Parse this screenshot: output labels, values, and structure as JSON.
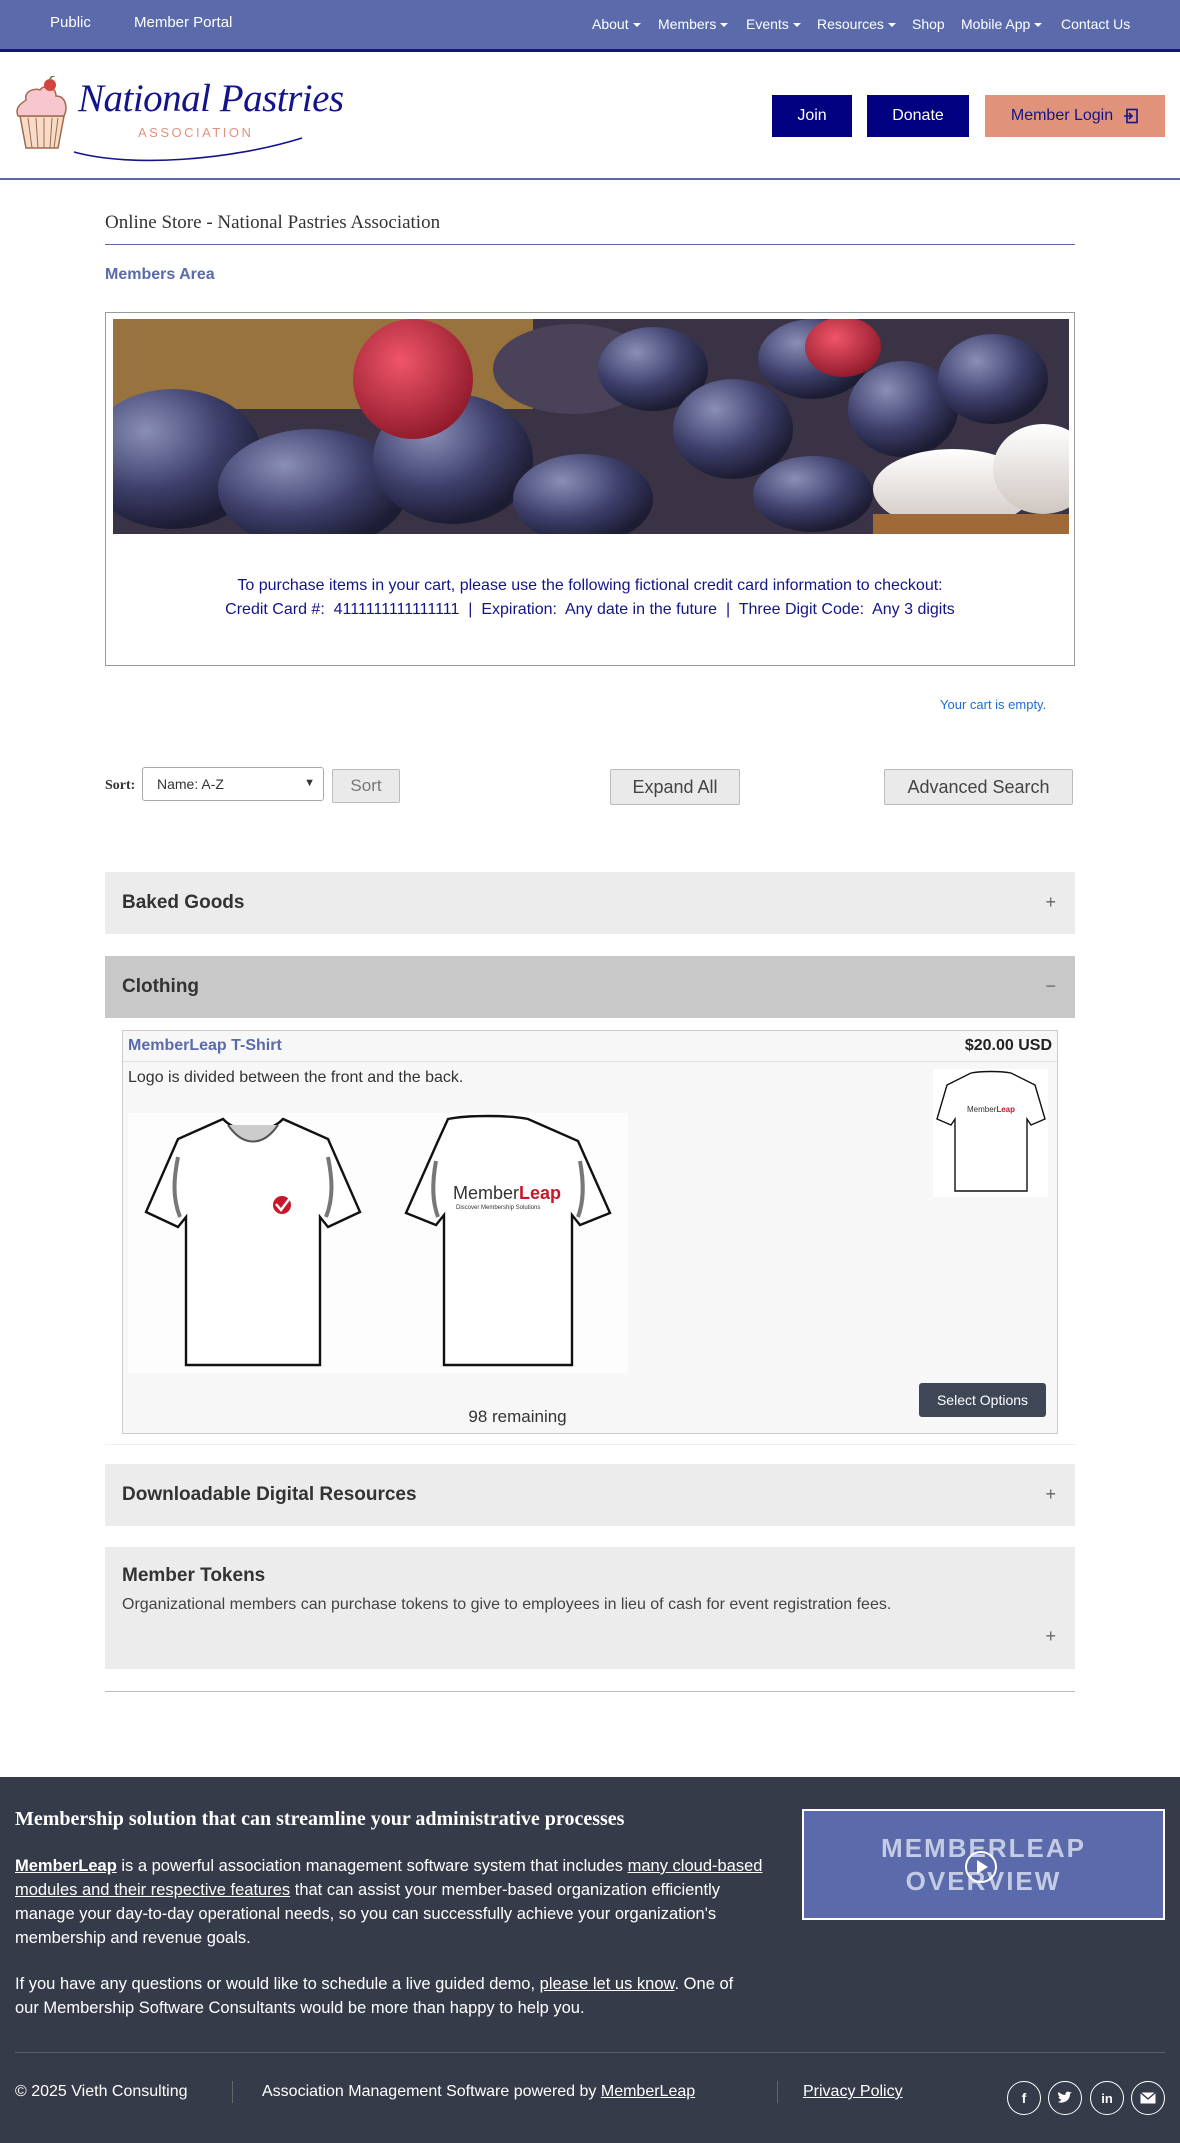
{
  "topbar": {
    "public": "Public",
    "member_portal": "Member Portal",
    "nav": [
      "About",
      "Members",
      "Events",
      "Resources",
      "Shop",
      "Mobile App",
      "Contact Us"
    ]
  },
  "logo": {
    "line1": "National Pastries",
    "line2": "ASSOCIATION"
  },
  "header_buttons": {
    "join": "Join",
    "donate": "Donate",
    "login": "Member Login"
  },
  "page": {
    "title": "Online Store - National Pastries Association",
    "members_area": "Members Area",
    "checkout_line1": "To purchase items in your cart, please use the following fictional credit card information to checkout:",
    "checkout_line2": "Credit Card #:  4111111111111111  |  Expiration:  Any date in the future  |  Three Digit Code:  Any 3 digits",
    "cart_status": "Your cart is empty."
  },
  "controls": {
    "sort_label": "Sort:",
    "sort_value": "Name: A-Z",
    "sort_button": "Sort",
    "expand_all": "Expand All",
    "advanced_search": "Advanced Search"
  },
  "categories": {
    "baked_goods": {
      "title": "Baked Goods",
      "toggle": "+"
    },
    "clothing": {
      "title": "Clothing",
      "toggle": "−"
    },
    "downloadable": {
      "title": "Downloadable Digital Resources",
      "toggle": "+"
    },
    "tokens": {
      "title": "Member Tokens",
      "desc": "Organizational members can purchase tokens to give to employees in lieu of cash for event registration fees.",
      "toggle": "+"
    }
  },
  "product": {
    "name": "MemberLeap T-Shirt",
    "price": "$20.00 USD",
    "description": "Logo is divided between the front and the back.",
    "select_options": "Select Options",
    "remaining": "98 remaining",
    "shirt_brand_1": "Member",
    "shirt_brand_2": "Leap",
    "shirt_tagline": "Discover Membership Solutions"
  },
  "footer": {
    "heading": "Membership solution that can streamline your administrative processes",
    "p1_link": "MemberLeap",
    "p1_a": " is a powerful association management software system that includes ",
    "p1_link2": "many cloud-based modules and their respective features",
    "p1_b": " that can assist your member-based organization efficiently manage your day-to-day operational needs, so you can successfully achieve your organization's membership and revenue goals.",
    "p2_a": "If you have any questions or would like to schedule a live guided demo, ",
    "p2_link": "please let us know",
    "p2_b": ". One of our Membership Software Consultants would be more than happy to help you.",
    "video_line1": "MEMBERLEAP",
    "video_line2": "OVERVIEW",
    "copyright": "© 2025 ",
    "company": "Vieth Consulting",
    "powered": "Association Management Software powered by ",
    "powered_link": "MemberLeap",
    "privacy": "Privacy Policy"
  },
  "colors": {
    "brand_blue": "#5a6aab",
    "navy": "#000080",
    "salmon": "#e0937a",
    "footer_bg": "#353b48"
  }
}
